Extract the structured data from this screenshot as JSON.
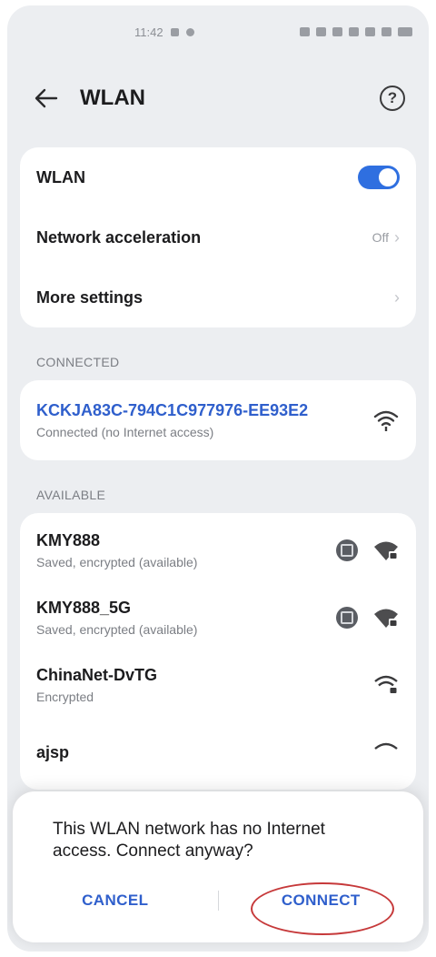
{
  "status_bar": {
    "time": "11:42"
  },
  "header": {
    "title": "WLAN",
    "back_icon": "back-arrow-icon",
    "help_icon": "help-icon",
    "help_glyph": "?"
  },
  "settings": {
    "wlan_label": "WLAN",
    "wlan_enabled": true,
    "acceleration_label": "Network acceleration",
    "acceleration_value": "Off",
    "more_label": "More settings"
  },
  "sections": {
    "connected": "CONNECTED",
    "available": "AVAILABLE"
  },
  "connected_network": {
    "name": "KCKJA83C-794C1C977976-EE93E2",
    "status": "Connected (no Internet access)"
  },
  "available_networks": [
    {
      "name": "KMY888",
      "status": "Saved, encrypted (available)"
    },
    {
      "name": "KMY888_5G",
      "status": "Saved, encrypted (available)"
    },
    {
      "name": "ChinaNet-DvTG",
      "status": "Encrypted"
    },
    {
      "name": "ajsp",
      "status": ""
    }
  ],
  "dialog": {
    "message": "This WLAN network has no Internet access. Connect anyway?",
    "cancel_label": "CANCEL",
    "connect_label": "CONNECT"
  },
  "colors": {
    "accent": "#2f5fcc",
    "toggle_on": "#2f6fe0",
    "highlight": "#c6393a"
  }
}
